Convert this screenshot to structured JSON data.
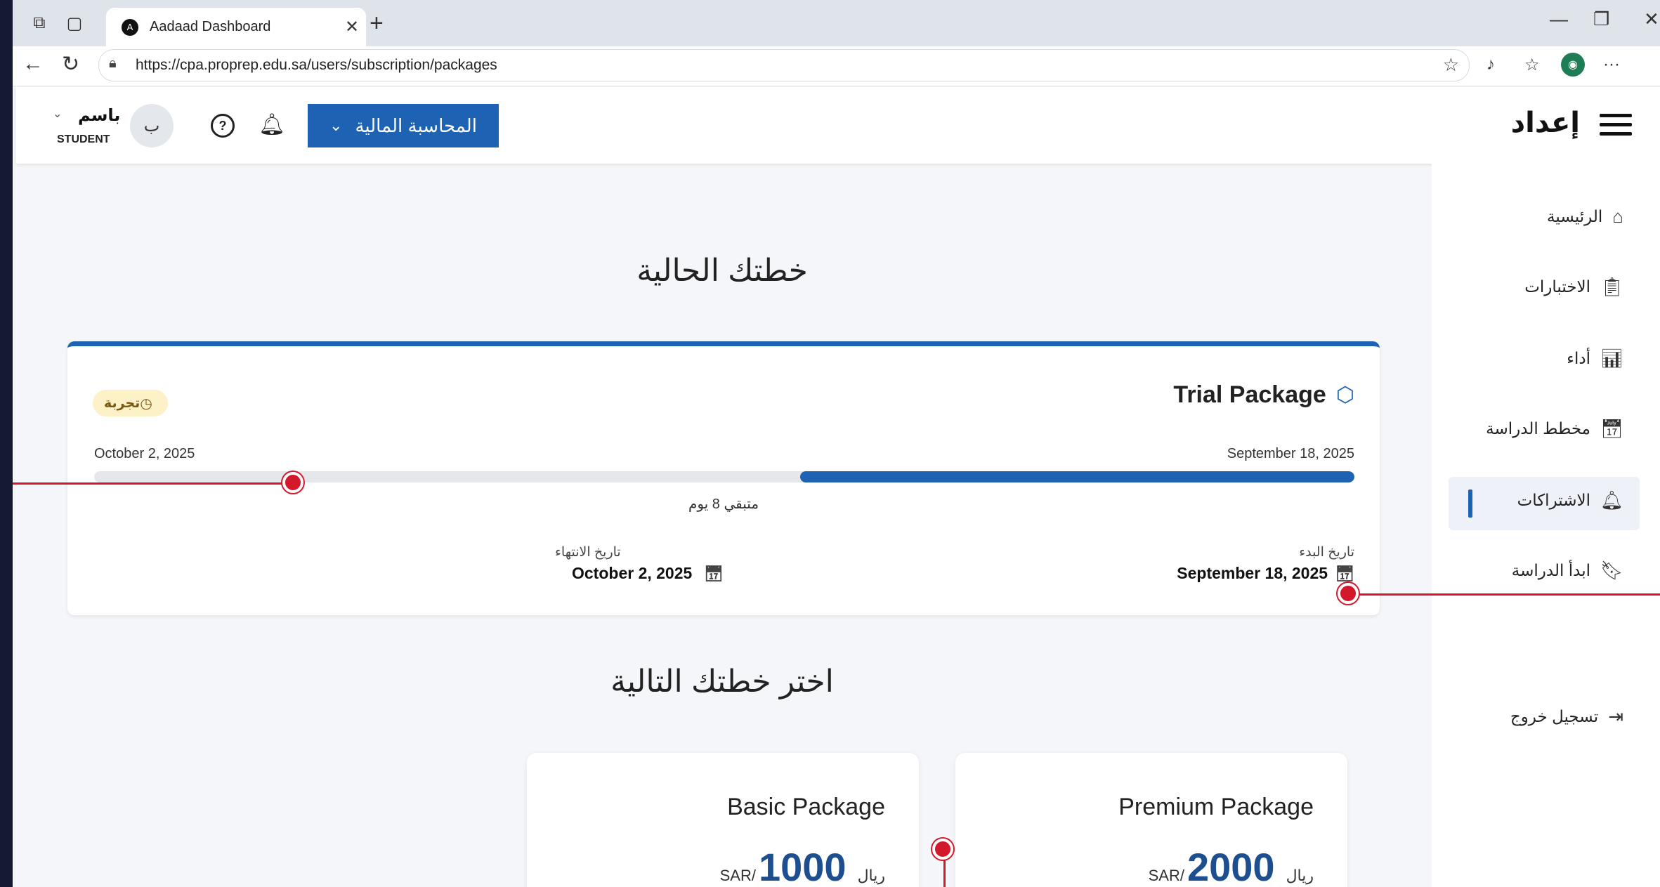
{
  "browser": {
    "tab_title": "Aadaad Dashboard",
    "tab_logo": "A",
    "url": "https://cpa.proprep.edu.sa/users/subscription/packages"
  },
  "header": {
    "logo_text": "إعداد",
    "course_button": "المحاسبة المالية",
    "user_initial": "ب",
    "user_name": "باسم",
    "user_role": "STUDENT"
  },
  "sidebar": {
    "items": [
      {
        "label": "الرئيسية",
        "icon": "home-icon"
      },
      {
        "label": "الاختبارات",
        "icon": "clipboard-icon"
      },
      {
        "label": "أداء",
        "icon": "chart-icon"
      },
      {
        "label": "مخطط الدراسة",
        "icon": "calendar-clock-icon"
      },
      {
        "label": "الاشتراكات",
        "icon": "bell-icon",
        "active": true
      },
      {
        "label": "ابدأ الدراسة",
        "icon": "book-icon"
      }
    ],
    "logout": "تسجيل خروج"
  },
  "current_plan": {
    "heading": "خطتك الحالية",
    "package_name": "Trial Package",
    "badge": "تجربة",
    "date_left": "October 2, 2025",
    "date_right": "September 18, 2025",
    "progress_elapsed_fraction": 0.44,
    "remaining_text": "متبقي 8 يوم",
    "end_label": "تاريخ الانتهاء",
    "end_value": "October 2, 2025",
    "start_label": "تاريخ البدء",
    "start_value": "September 18, 2025"
  },
  "next_plan": {
    "heading": "اختر خطتك التالية",
    "packages": [
      {
        "name": "Basic Package",
        "riyal": "ريال",
        "amount": "1000",
        "currency": "SAR/"
      },
      {
        "name": "Premium Package",
        "riyal": "ريال",
        "amount": "2000",
        "currency": "SAR/"
      }
    ]
  },
  "colors": {
    "primary": "#1d62b3",
    "annotation": "#d4182b",
    "badge_bg": "#fdf1c8"
  }
}
